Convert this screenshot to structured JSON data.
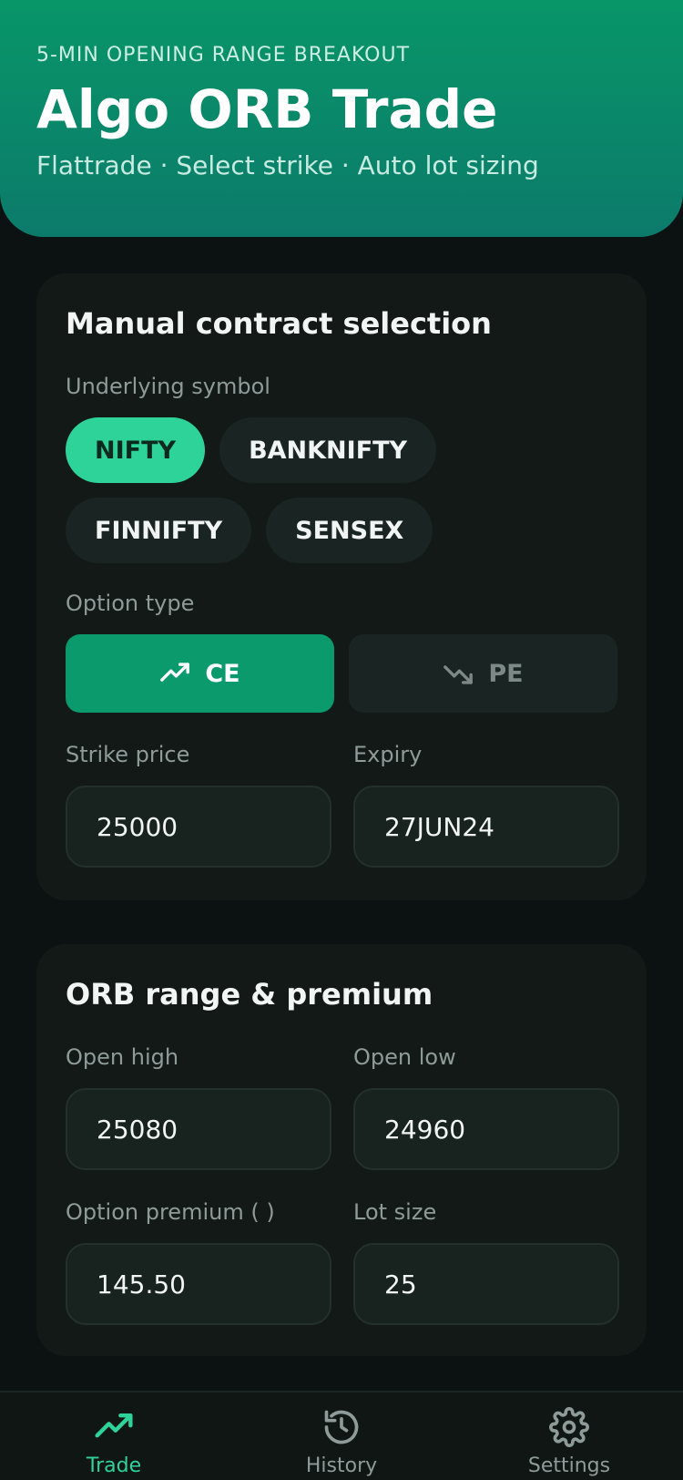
{
  "header": {
    "eyebrow": "5-MIN OPENING RANGE BREAKOUT",
    "title": "Algo ORB Trade",
    "subtitle": "Flattrade · Select strike · Auto lot sizing"
  },
  "contract": {
    "title": "Manual contract selection",
    "symbol_label": "Underlying symbol",
    "symbols": [
      "NIFTY",
      "BANKNIFTY",
      "FINNIFTY",
      "SENSEX"
    ],
    "selected_symbol": "NIFTY",
    "option_type_label": "Option type",
    "ce_label": "CE",
    "pe_label": "PE",
    "selected_option_type": "CE",
    "strike_label": "Strike price",
    "strike_value": "25000",
    "expiry_label": "Expiry",
    "expiry_value": "27JUN24"
  },
  "orb": {
    "title": "ORB range & premium",
    "open_high_label": "Open high",
    "open_high_value": "25080",
    "open_low_label": "Open low",
    "open_low_value": "24960",
    "premium_label": "Option premium (  )",
    "premium_value": "145.50",
    "lot_size_label": "Lot size",
    "lot_size_value": "25"
  },
  "tabs": [
    {
      "label": "Trade",
      "icon": "trending-up-icon",
      "active": true
    },
    {
      "label": "History",
      "icon": "history-icon",
      "active": false
    },
    {
      "label": "Settings",
      "icon": "gear-icon",
      "active": false
    }
  ],
  "colors": {
    "accent": "#2ed39a",
    "header_gradient_top": "#089668",
    "header_gradient_bottom": "#0c7a6b",
    "background": "#0b1211",
    "card": "#121917"
  }
}
